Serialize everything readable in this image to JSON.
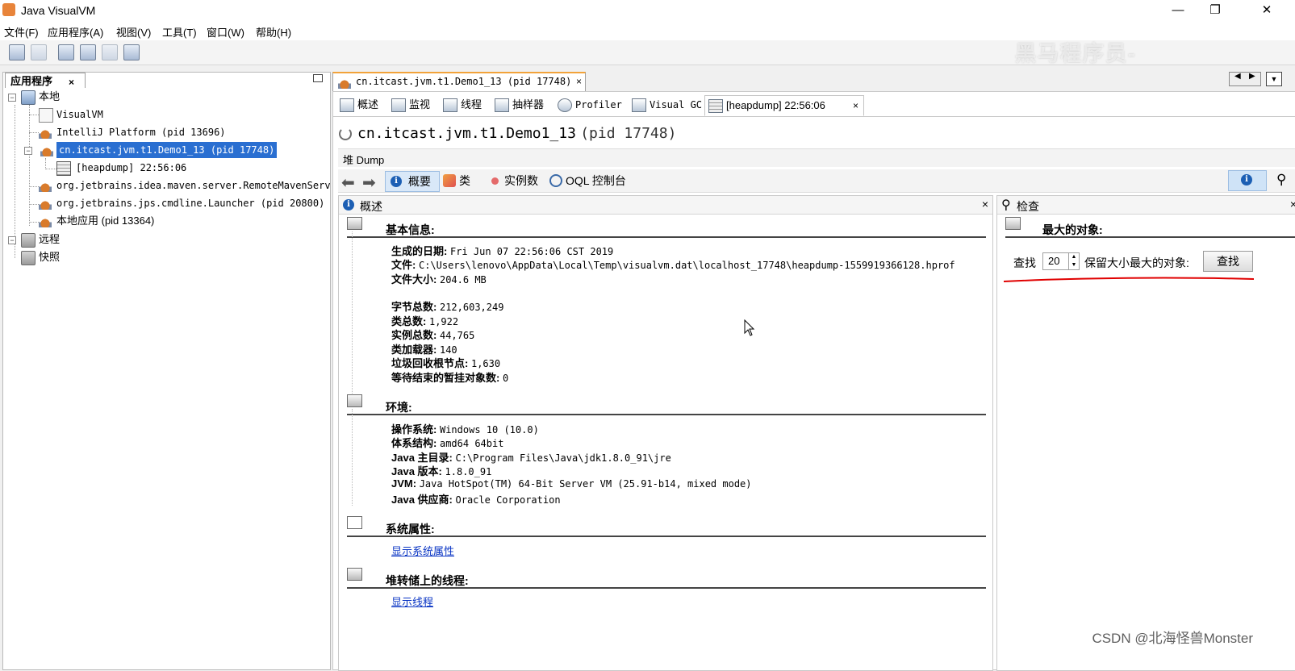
{
  "window": {
    "title": "Java VisualVM",
    "minimize": "—",
    "maximize": "❐",
    "close": "✕"
  },
  "menu": [
    "文件(F)",
    "应用程序(A)",
    "视图(V)",
    "工具(T)",
    "窗口(W)",
    "帮助(H)"
  ],
  "watermark_top": "黑马程序员-",
  "left_panel": {
    "tab_label": "应用程序",
    "tab_close": "×",
    "tree": {
      "local": "本地",
      "visualvm": "VisualVM",
      "intellij": "IntelliJ Platform (pid 13696)",
      "selected_app": "cn.itcast.jvm.t1.Demo1_13 (pid 17748)",
      "heapdump": "[heapdump] 22:56:06",
      "maven": "org.jetbrains.idea.maven.server.RemoteMavenServe",
      "launcher": "org.jetbrains.jps.cmdline.Launcher (pid 20800)",
      "local_app": "本地应用 (pid 13364)",
      "remote": "远程",
      "snapshots": "快照"
    }
  },
  "doc_tab": {
    "label": "cn.itcast.jvm.t1.Demo1_13 (pid 17748)",
    "close": "×"
  },
  "subtabs": {
    "overview": "概述",
    "monitor": "监视",
    "threads": "线程",
    "sampler": "抽样器",
    "profiler": "Profiler",
    "visual_gc": "Visual GC",
    "heapdump": "[heapdump] 22:56:06",
    "close": "×"
  },
  "heading": {
    "name": "cn.itcast.jvm.t1.Demo1_13",
    "pid": "(pid 17748)"
  },
  "heap_bar_label": "堆 Dump",
  "views": {
    "summary": "概要",
    "classes": "类",
    "instances": "实例数",
    "oql": "OQL 控制台"
  },
  "summary_pane": {
    "title": "概述",
    "close": "×",
    "basic": {
      "title": "基本信息:",
      "date_k": "生成的日期:",
      "date_v": "Fri Jun 07 22:56:06 CST 2019",
      "file_k": "文件:",
      "file_v": "C:\\Users\\lenovo\\AppData\\Local\\Temp\\visualvm.dat\\localhost_17748\\heapdump-1559919366128.hprof",
      "size_k": "文件大小:",
      "size_v": "204.6 MB",
      "bytes_k": "字节总数:",
      "bytes_v": "212,603,249",
      "classes_k": "类总数:",
      "classes_v": "1,922",
      "instances_k": "实例总数:",
      "instances_v": "44,765",
      "loaders_k": "类加载器:",
      "loaders_v": "140",
      "gcroots_k": "垃圾回收根节点:",
      "gcroots_v": "1,630",
      "pending_k": "等待结束的暂挂对象数:",
      "pending_v": "0"
    },
    "env": {
      "title": "环境:",
      "os_k": "操作系统:",
      "os_v": "Windows 10 (10.0)",
      "arch_k": "体系结构:",
      "arch_v": "amd64 64bit",
      "home_k": "Java 主目录:",
      "home_v": "C:\\Program Files\\Java\\jdk1.8.0_91\\jre",
      "version_k": "Java 版本:",
      "version_v": "1.8.0_91",
      "jvm_k": "JVM:",
      "jvm_v": "Java HotSpot(TM) 64-Bit Server VM (25.91-b14, mixed mode)",
      "vendor_k": "Java 供应商:",
      "vendor_v": "Oracle Corporation"
    },
    "sysprops": {
      "title": "系统属性:",
      "link": "显示系统属性"
    },
    "threads": {
      "title": "堆转储上的线程:",
      "link": "显示线程"
    }
  },
  "inspect_pane": {
    "title": "检查",
    "close": "×",
    "section": "最大的对象:",
    "find_label": "查找",
    "count": "20",
    "retained_label": "保留大小最大的对象:",
    "find_button": "查找"
  },
  "watermark_bottom": "CSDN @北海怪兽Monster",
  "colors": {
    "selection": "#2a6fd1",
    "active_tab_accent": "#f2a33a",
    "link": "#0a35c4",
    "red_underline": "#e00000"
  }
}
